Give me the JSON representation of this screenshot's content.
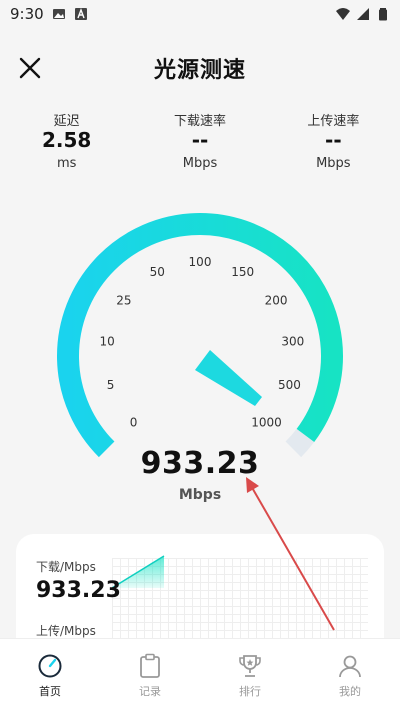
{
  "status": {
    "time": "9:30"
  },
  "header": {
    "title": "光源测速"
  },
  "metrics": [
    {
      "label": "延迟",
      "value": "2.58",
      "unit": "ms"
    },
    {
      "label": "下载速率",
      "value": "--",
      "unit": "Mbps"
    },
    {
      "label": "上传速率",
      "value": "--",
      "unit": "Mbps"
    }
  ],
  "gauge": {
    "ticks": [
      "0",
      "5",
      "10",
      "25",
      "50",
      "100",
      "150",
      "200",
      "300",
      "500",
      "1000"
    ],
    "reading": "933.23",
    "unit": "Mbps",
    "colors": {
      "start": "#1ad3ee",
      "end": "#17e3c4",
      "empty": "#e3e9ef"
    }
  },
  "card": {
    "download_label": "下载/Mbps",
    "download_value": "933.23",
    "upload_label": "上传/Mbps"
  },
  "nav": [
    {
      "label": "首页",
      "icon": "speedometer-icon",
      "active": true
    },
    {
      "label": "记录",
      "icon": "clipboard-icon",
      "active": false
    },
    {
      "label": "排行",
      "icon": "trophy-icon",
      "active": false
    },
    {
      "label": "我的",
      "icon": "user-icon",
      "active": false
    }
  ],
  "accent": "#d94a4a"
}
